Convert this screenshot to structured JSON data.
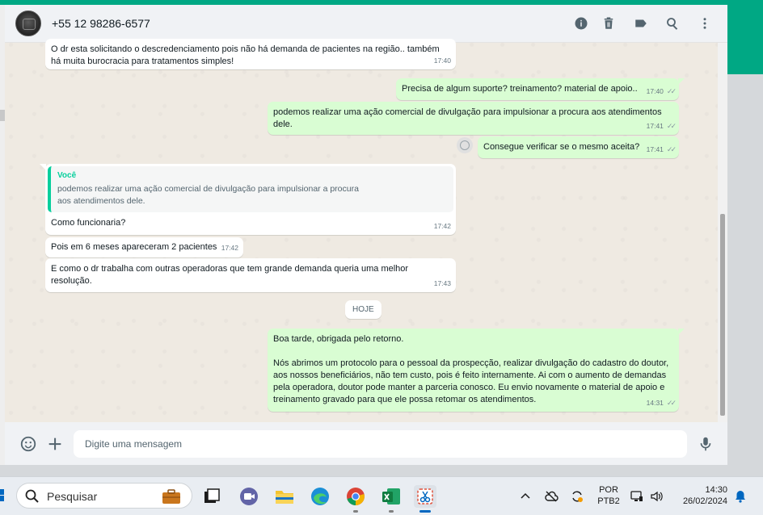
{
  "header": {
    "contact_name": "+55 12 98286-6577",
    "icons": [
      "info-icon",
      "trash-icon",
      "label-icon",
      "search-icon",
      "menu-icon"
    ]
  },
  "messages": [
    {
      "direction": "in",
      "text": "O dr esta solicitando o descredenciamento pois não há demanda de pacientes na região.. também há muita burocracia para tratamentos simples!",
      "time": "17:40"
    },
    {
      "direction": "out",
      "text": "Precisa de algum suporte? treinamento? material de apoio..",
      "time": "17:40"
    },
    {
      "direction": "out",
      "text": "podemos realizar uma ação comercial de divulgação para impulsionar a procura aos atendimentos dele.",
      "time": "17:41"
    },
    {
      "direction": "out",
      "text": "Consegue verificar se o mesmo aceita?",
      "time": "17:41"
    },
    {
      "direction": "in",
      "quote_author": "Você",
      "quote_text": "podemos realizar uma ação comercial de divulgação para impulsionar a procura aos atendimentos dele.",
      "text": "Como funcionaria?",
      "time": "17:42"
    },
    {
      "direction": "in",
      "text": "Pois em 6 meses apareceram 2 pacientes",
      "time": "17:42"
    },
    {
      "direction": "in",
      "text": "E como o dr trabalha com outras operadoras que tem grande demanda queria uma melhor resolução.",
      "time": "17:43"
    },
    {
      "direction": "out",
      "text_line1": "Boa tarde, obrigada pelo retorno.",
      "text_line2": "Nós abrimos um protocolo para o pessoal da prospecção, realizar divulgação do cadastro do doutor, aos nossos beneficiários, não tem custo, pois é feito internamente. Ai com o aumento de demandas pela operadora, doutor pode manter a parceria conosco. Eu envio novamente o material de apoio e treinamento gravado para que ele possa retomar os atendimentos.",
      "time": "14:31"
    }
  ],
  "day_separator": "HOJE",
  "composer": {
    "placeholder": "Digite uma mensagem"
  },
  "taskbar": {
    "search_label": "Pesquisar",
    "language_line1": "POR",
    "language_line2": "PTB2",
    "time": "14:30",
    "date": "26/02/2024"
  },
  "colors": {
    "accent_green": "#00a884",
    "outgoing_bubble": "#d9fdd3",
    "incoming_bubble": "#ffffff",
    "chat_background": "#efeae2",
    "quote_accent": "#06cf9c"
  }
}
